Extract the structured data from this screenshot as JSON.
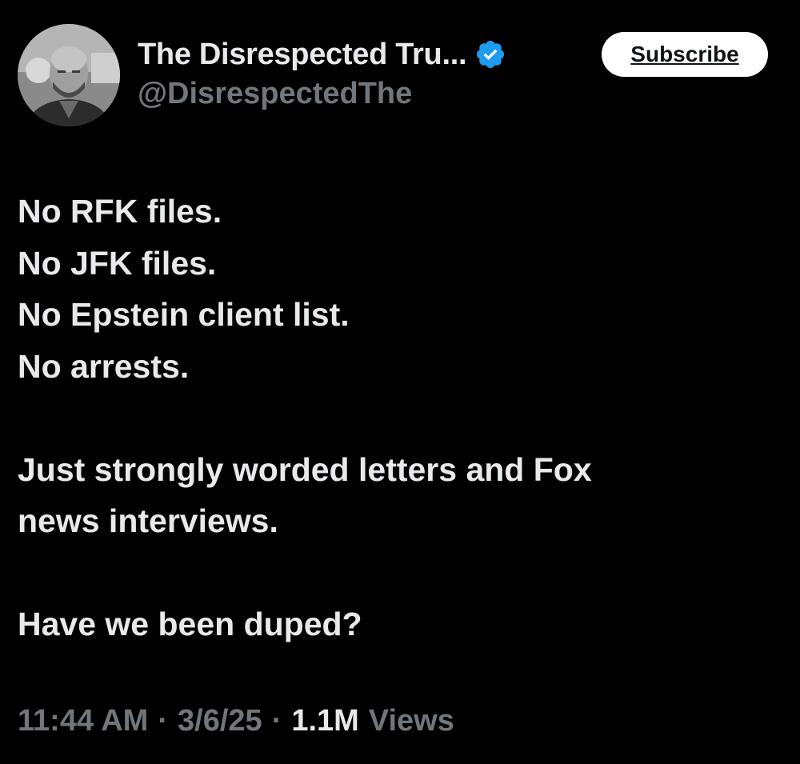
{
  "author": {
    "display_name": "The Disrespected Tru...",
    "handle": "@DisrespectedThe",
    "verified": true,
    "badge_color": "#1d9bf0"
  },
  "header": {
    "subscribe_label": "Subscribe"
  },
  "tweet": {
    "lines": [
      "No RFK files.",
      "No JFK files.",
      "No Epstein client list.",
      "No arrests.",
      "",
      "Just strongly worded letters and Fox",
      "news interviews.",
      "",
      "Have we been duped?"
    ]
  },
  "meta": {
    "time": "11:44 AM",
    "date": "3/6/25",
    "views_count": "1.1M",
    "views_label": "Views",
    "separator": "·"
  },
  "colors": {
    "background": "#000000",
    "primary_text": "#e7e9ea",
    "secondary_text": "#71767b",
    "button_bg": "#ffffff"
  }
}
